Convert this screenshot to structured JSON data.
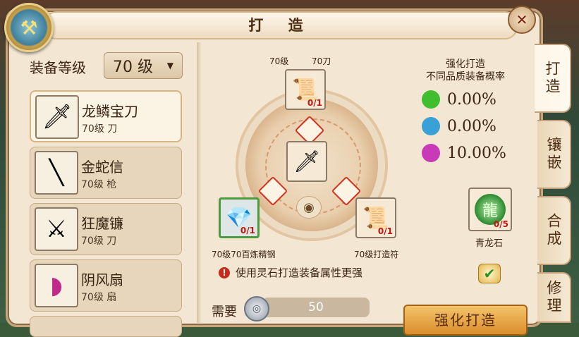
{
  "window": {
    "title": "打 造"
  },
  "left_panel": {
    "level_label": "装备等级",
    "level_select": "70 级",
    "items": [
      {
        "name": "龙鳞宝刀",
        "sub": "70级 刀",
        "icon": "blade"
      },
      {
        "name": "金蛇信",
        "sub": "70级 枪",
        "icon": "spear"
      },
      {
        "name": "狂魔镰",
        "sub": "70级 刀",
        "icon": "scythe"
      },
      {
        "name": "阴风扇",
        "sub": "70级 扇",
        "icon": "fan"
      }
    ]
  },
  "forge": {
    "top_labels": [
      "70级",
      "70刀"
    ],
    "top_slot_count": "0/1",
    "left_slot_count": "0/1",
    "right_slot_count": "0/1",
    "left_label": "70级70百炼精钢",
    "right_label": "70级打造符",
    "note": "使用灵石打造装备属性更强",
    "need_label": "需要",
    "need_value": "50",
    "rate_title_1": "强化打造",
    "rate_title_2": "不同品质装备概率",
    "rates": [
      {
        "color": "#3fbf2e",
        "value": "0.00%"
      },
      {
        "color": "#3aa0d8",
        "value": "0.00%"
      },
      {
        "color": "#c93ab8",
        "value": "10.00%"
      }
    ],
    "stone_count": "0/5",
    "stone_name": "青龙石",
    "forge_button": "强化打造"
  },
  "tabs": [
    "打造",
    "镶嵌",
    "合成",
    "修理"
  ]
}
